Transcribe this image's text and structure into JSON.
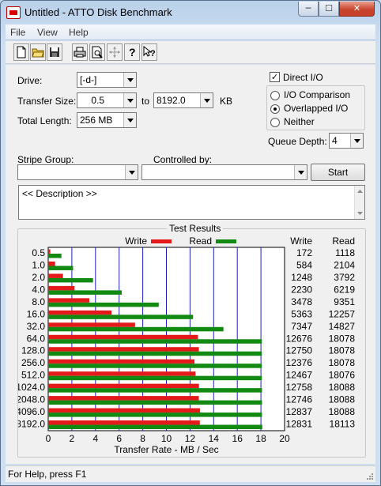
{
  "window": {
    "title": "Untitled - ATTO Disk Benchmark",
    "min_glyph": "─",
    "max_glyph": "☐",
    "close_glyph": "✕"
  },
  "menu": [
    "File",
    "View",
    "Help"
  ],
  "toolbar": [
    "new-file-icon",
    "open-folder-icon",
    "save-icon",
    "print-icon",
    "print-preview-icon",
    "move-icon",
    "help-icon",
    "context-help-icon"
  ],
  "form": {
    "drive_label": "Drive:",
    "drive_value": "[-d-]",
    "transfer_size_label": "Transfer Size:",
    "transfer_from": "0.5",
    "transfer_to_label": "to",
    "transfer_to": "8192.0",
    "transfer_unit": "KB",
    "total_length_label": "Total Length:",
    "total_length_value": "256 MB",
    "direct_io_label": "Direct I/O",
    "direct_io_checked": true,
    "io_options": [
      "I/O Comparison",
      "Overlapped I/O",
      "Neither"
    ],
    "io_selected": "Overlapped I/O",
    "queue_depth_label": "Queue Depth:",
    "queue_depth_value": "4",
    "stripe_group_label": "Stripe Group:",
    "stripe_group_value": "",
    "controlled_by_label": "Controlled by:",
    "controlled_by_value": "",
    "start_label": "Start",
    "description": "<< Description >>"
  },
  "results_title": "Test Results",
  "table_headers": {
    "write": "Write",
    "read": "Read"
  },
  "chart_data": {
    "type": "bar",
    "orientation": "horizontal",
    "categories": [
      "0.5",
      "1.0",
      "2.0",
      "4.0",
      "8.0",
      "16.0",
      "32.0",
      "64.0",
      "128.0",
      "256.0",
      "512.0",
      "1024.0",
      "2048.0",
      "4096.0",
      "8192.0"
    ],
    "series": [
      {
        "name": "Write",
        "color": "#e41a1a",
        "values": [
          172,
          584,
          1248,
          2230,
          3478,
          5363,
          7347,
          12676,
          12750,
          12376,
          12467,
          12758,
          12746,
          12837,
          12831
        ]
      },
      {
        "name": "Read",
        "color": "#128a12",
        "values": [
          1118,
          2104,
          3792,
          6219,
          9351,
          12257,
          14827,
          18078,
          18078,
          18078,
          18076,
          18088,
          18088,
          18088,
          18113
        ]
      }
    ],
    "xlabel": "Transfer Rate - MB / Sec",
    "x_ticks": [
      "0",
      "2",
      "4",
      "6",
      "8",
      "10",
      "12",
      "14",
      "16",
      "18",
      "20"
    ],
    "xlim": [
      0,
      20
    ],
    "legend_position": "top",
    "grid": true,
    "grid_color": "#2020c0"
  },
  "status": "For Help, press F1"
}
